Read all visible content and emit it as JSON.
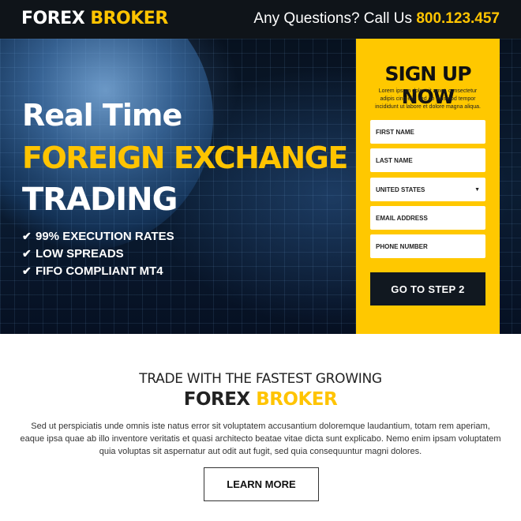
{
  "header": {
    "logo": {
      "part1": "FOREX",
      "part2": "BROKER"
    },
    "questions_text": "Any Questions? Call Us",
    "phone": "800.123.457"
  },
  "hero": {
    "headline_line1": "Real Time",
    "headline_line2": "FOREIGN EXCHANGE",
    "headline_line3": "TRADING",
    "features": [
      "99% EXECUTION RATES",
      "LOW SPREADS",
      "FIFO COMPLIANT MT4"
    ]
  },
  "signup": {
    "title": "SIGN UP NOW",
    "description": "Lorem ipsum dolor sit amet, consectetur adipis cing elit, sed do eiusmod tempor incididunt ut labore et dolore magna aliqua.",
    "first_name_placeholder": "FIRST NAME",
    "last_name_placeholder": "LAST NAME",
    "country_selected": "UNITED STATES",
    "email_placeholder": "EMAIL ADDRESS",
    "phone_placeholder": "PHONE NUMBER",
    "submit_label": "GO TO STEP 2"
  },
  "about": {
    "tagline": "TRADE WITH THE FASTEST GROWING",
    "brand_part1": "FOREX",
    "brand_part2": "BROKER",
    "body": "Sed ut perspiciatis unde omnis iste natus error sit voluptatem accusantium doloremque laudantium, totam rem aperiam, eaque ipsa quae ab illo inventore veritatis et quasi architecto beatae vitae dicta sunt explicabo. Nemo enim ipsam voluptatem quia voluptas sit aspernatur aut odit aut fugit, sed quia consequuntur magni dolores.",
    "learn_more_label": "LEARN MORE"
  },
  "colors": {
    "accent": "#ffc400",
    "header_bg": "#0f1419",
    "button_dark": "#111820"
  }
}
